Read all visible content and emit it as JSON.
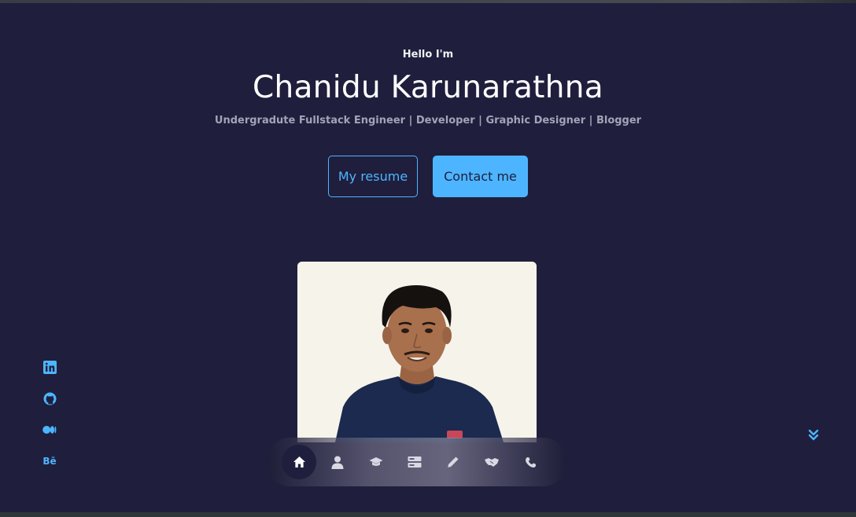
{
  "hero": {
    "greeting": "Hello I'm",
    "name": "Chanidu Karunarathna",
    "tagline": "Undergradute Fullstack Engineer | Developer | Graphic Designer | Blogger"
  },
  "actions": {
    "resume_label": "My resume",
    "contact_label": "Contact me"
  },
  "socials": {
    "items": [
      {
        "icon": "linkedin-icon"
      },
      {
        "icon": "github-icon"
      },
      {
        "icon": "medium-icon"
      },
      {
        "icon": "behance-icon",
        "text": "Bē"
      }
    ]
  },
  "nav": {
    "items": [
      {
        "icon": "home-icon",
        "active": true
      },
      {
        "icon": "user-icon",
        "active": false
      },
      {
        "icon": "graduation-cap-icon",
        "active": false
      },
      {
        "icon": "server-icon",
        "active": false
      },
      {
        "icon": "pencil-icon",
        "active": false
      },
      {
        "icon": "handshake-icon",
        "active": false
      },
      {
        "icon": "phone-icon",
        "active": false
      }
    ]
  },
  "colors": {
    "background": "#1f1e3c",
    "accent": "#4db5ff",
    "muted_text": "#a3a3b8"
  }
}
